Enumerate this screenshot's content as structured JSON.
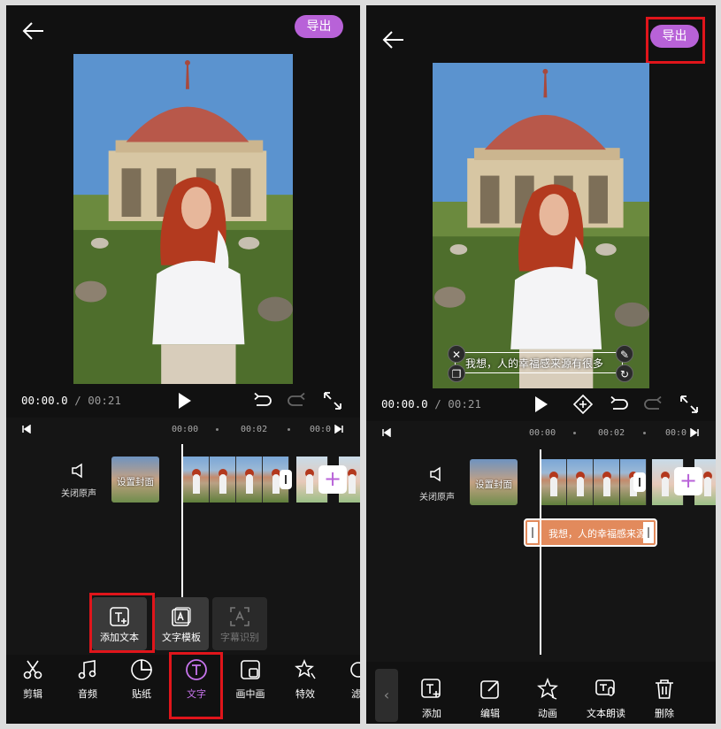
{
  "left": {
    "export_label": "导出",
    "time_current": "00:00.0",
    "time_separator": " / ",
    "time_total": "00:21",
    "ruler": [
      "00:00",
      "00:02",
      "00:0"
    ],
    "mute_label": "关闭原声",
    "cover_label": "设置封面",
    "popup": [
      {
        "label": "添加文本",
        "icon": "add-text-icon"
      },
      {
        "label": "文字模板",
        "icon": "text-template-icon"
      },
      {
        "label": "字幕识别",
        "icon": "subtitle-recognition-icon"
      }
    ],
    "toolbar": [
      {
        "label": "剪辑",
        "icon": "scissors-icon"
      },
      {
        "label": "音频",
        "icon": "music-icon"
      },
      {
        "label": "贴纸",
        "icon": "sticker-icon"
      },
      {
        "label": "文字",
        "icon": "text-icon"
      },
      {
        "label": "画中画",
        "icon": "picture-in-picture-icon"
      },
      {
        "label": "特效",
        "icon": "effects-icon"
      },
      {
        "label": "滤",
        "icon": "filter-icon"
      }
    ]
  },
  "right": {
    "export_label": "导出",
    "time_current": "00:00.0",
    "time_separator": " / ",
    "time_total": "00:21",
    "ruler": [
      "00:00",
      "00:02",
      "00:0"
    ],
    "mute_label": "关闭原声",
    "cover_label": "设置封面",
    "caption_text": "我想，人的幸福感来源有很多",
    "text_clip_label": "我想，人的幸福感来源",
    "toolbar": [
      {
        "label": "添加",
        "icon": "add-text-icon"
      },
      {
        "label": "编辑",
        "icon": "edit-icon"
      },
      {
        "label": "动画",
        "icon": "animation-star-icon"
      },
      {
        "label": "文本朗读",
        "icon": "text-to-speech-icon"
      },
      {
        "label": "删除",
        "icon": "trash-icon"
      }
    ]
  },
  "colors": {
    "accent": "#b862d8",
    "highlight": "#e0151b",
    "text_clip": "#e28a5c"
  }
}
